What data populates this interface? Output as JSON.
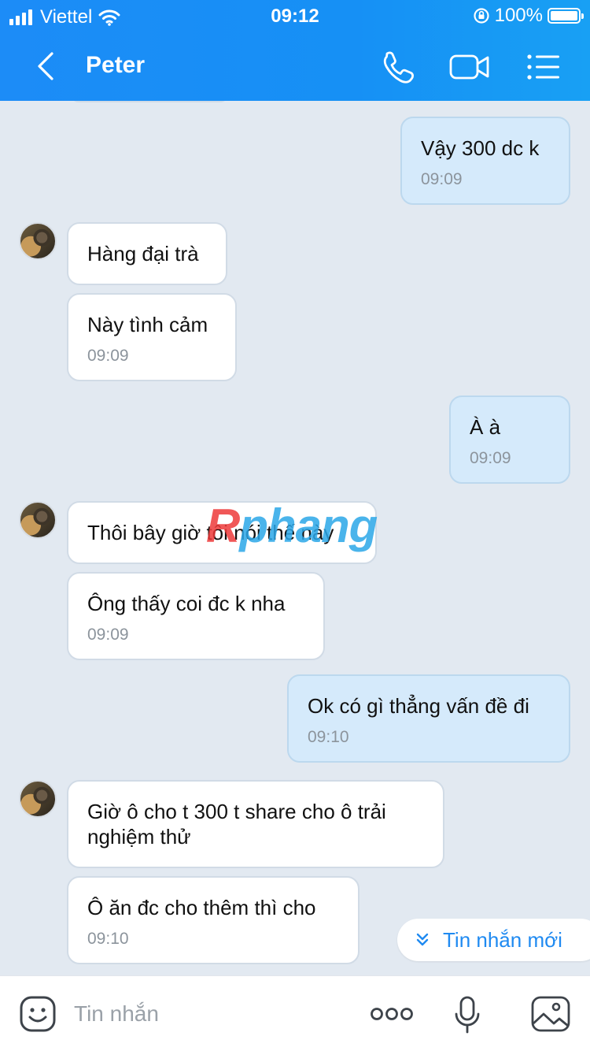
{
  "status_bar": {
    "carrier": "Viettel",
    "time": "09:12",
    "battery": "100%"
  },
  "header": {
    "title": "Peter"
  },
  "messages": [
    {
      "side": "mine",
      "text": "Vậy 300 dc k",
      "time": "09:09"
    },
    {
      "side": "theirs",
      "text": "Hàng đại trà"
    },
    {
      "side": "theirs",
      "text": "Này tình cảm",
      "time": "09:09"
    },
    {
      "side": "mine",
      "text": "À à",
      "time": "09:09"
    },
    {
      "side": "theirs",
      "text": "Thôi bây giờ tôi nói thế này"
    },
    {
      "side": "theirs",
      "text": "Ông thấy coi đc k nha",
      "time": "09:09"
    },
    {
      "side": "mine",
      "text": "Ok có gì thẳng vấn đề đi",
      "time": "09:10"
    },
    {
      "side": "theirs",
      "text": "Giờ ô cho t 300 t share cho ô trải nghiệm thử"
    },
    {
      "side": "theirs",
      "text": "Ô ăn đc cho thêm thì cho",
      "time": "09:10"
    }
  ],
  "watermark": {
    "part1": "R",
    "part2": "phang"
  },
  "new_messages_label": "Tin nhắn mới",
  "input": {
    "placeholder": "Tin nhắn"
  },
  "colors": {
    "header": "#1c8cf7",
    "mine_bubble": "#d5eafb",
    "theirs_bubble": "#ffffff",
    "background": "#e2e9f1",
    "accent": "#1f8af1"
  }
}
